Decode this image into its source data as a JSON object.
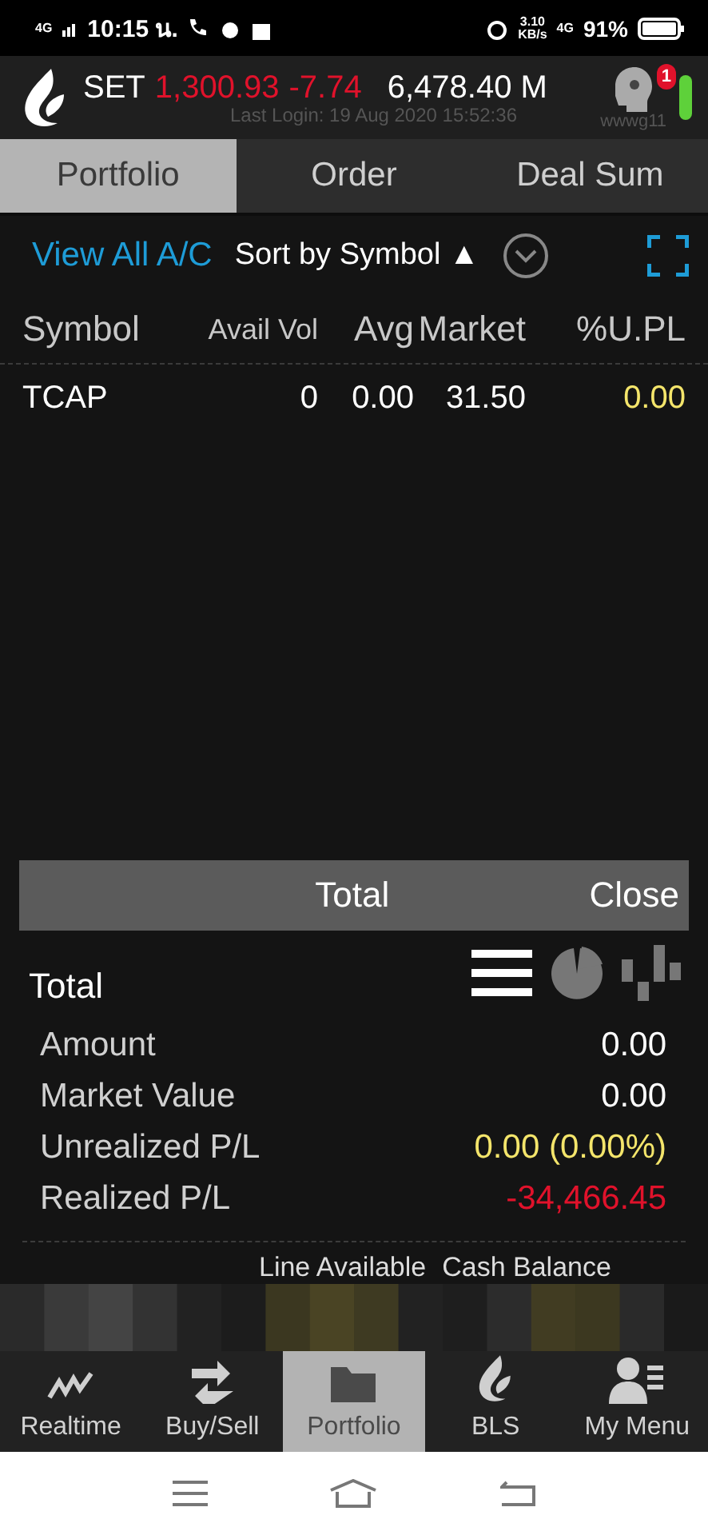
{
  "status_bar": {
    "network": "4G",
    "time": "10:15 น.",
    "speed": "3.10",
    "speed_unit": "KB/s",
    "network_right": "4G",
    "battery": "91%"
  },
  "header": {
    "index": "SET",
    "value": "1,300.93",
    "change": "-7.74",
    "volume": "6,478.40 M",
    "last_login": "Last Login: 19 Aug 2020 15:52:36",
    "user": "wwwg11",
    "badge": "1"
  },
  "tabs": [
    {
      "label": "Portfolio",
      "selected": true
    },
    {
      "label": "Order",
      "selected": false
    },
    {
      "label": "Deal Sum",
      "selected": false
    }
  ],
  "toolbar": {
    "view_all": "View All A/C",
    "sort": "Sort by Symbol",
    "sort_arrow": "▲"
  },
  "table": {
    "columns": [
      "Symbol",
      "Avail Vol",
      "Avg",
      "Market",
      "%U.PL"
    ],
    "rows": [
      {
        "cells": [
          "TCAP",
          "0",
          "0.00",
          "31.50",
          "0.00"
        ],
        "color": "#f4e56b"
      }
    ]
  },
  "total_bar": {
    "title": "Total",
    "close": "Close"
  },
  "summary": {
    "title": "Total",
    "views": [
      {
        "kind": "list",
        "selected": true
      },
      {
        "kind": "pie",
        "selected": false
      },
      {
        "kind": "bars",
        "selected": false
      }
    ],
    "rows": [
      {
        "label": "Amount",
        "value": "0.00",
        "color": "#ffffff"
      },
      {
        "label": "Market Value",
        "value": "0.00",
        "color": "#ffffff"
      },
      {
        "label": "Unrealized P/L",
        "value": "0.00 (0.00%)",
        "color": "#f4e56b"
      },
      {
        "label": "Realized P/L",
        "value": "-34,466.45",
        "color": "#e0122b"
      }
    ]
  },
  "account_labels": [
    "Line Available",
    "Cash Balance"
  ],
  "bottom_nav": [
    {
      "label": "Realtime",
      "kind": "realtime",
      "selected": false
    },
    {
      "label": "Buy/Sell",
      "kind": "buysell",
      "selected": false
    },
    {
      "label": "Portfolio",
      "kind": "portfolio",
      "selected": true
    },
    {
      "label": "BLS",
      "kind": "bls",
      "selected": false
    },
    {
      "label": "My Menu",
      "kind": "menu",
      "selected": false
    }
  ]
}
